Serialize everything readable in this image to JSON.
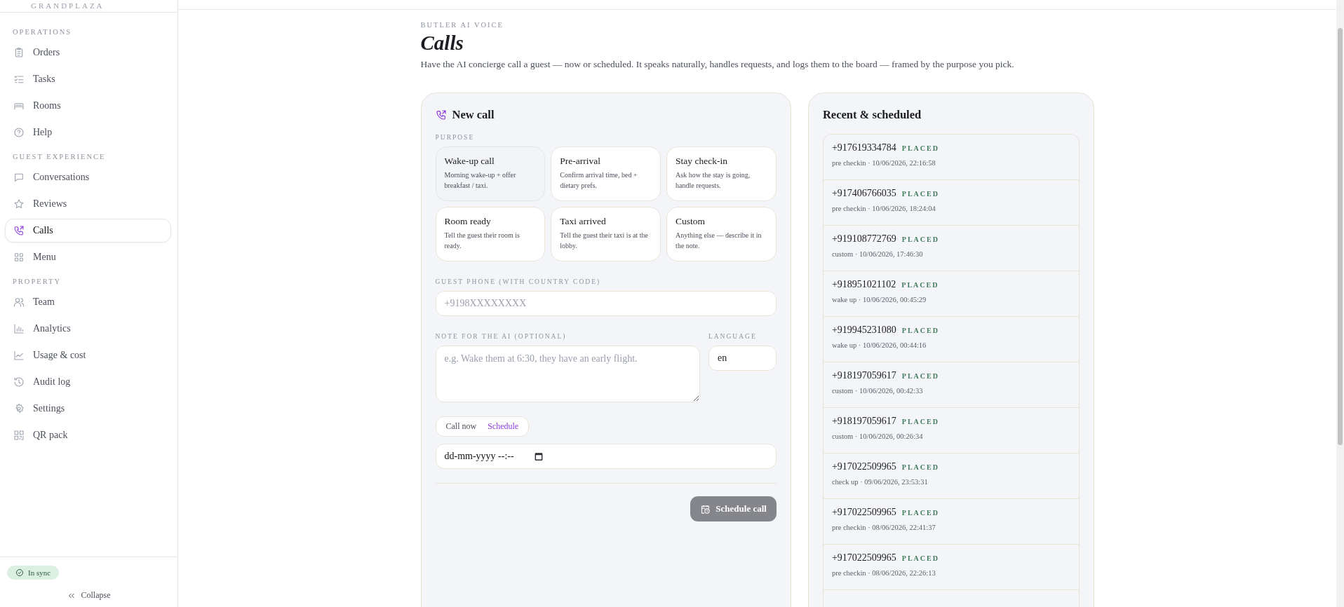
{
  "sidebar": {
    "brand": "GRANDPLAZA",
    "sections": [
      {
        "title": "OPERATIONS",
        "items": [
          {
            "label": "Orders",
            "selected": false
          },
          {
            "label": "Tasks",
            "selected": false
          },
          {
            "label": "Rooms",
            "selected": false
          },
          {
            "label": "Help",
            "selected": false
          }
        ]
      },
      {
        "title": "GUEST EXPERIENCE",
        "items": [
          {
            "label": "Conversations",
            "selected": false
          },
          {
            "label": "Reviews",
            "selected": false
          },
          {
            "label": "Calls",
            "selected": true
          },
          {
            "label": "Menu",
            "selected": false
          }
        ]
      },
      {
        "title": "PROPERTY",
        "items": [
          {
            "label": "Team",
            "selected": false
          },
          {
            "label": "Analytics",
            "selected": false
          },
          {
            "label": "Usage & cost",
            "selected": false
          },
          {
            "label": "Audit log",
            "selected": false
          },
          {
            "label": "Settings",
            "selected": false
          },
          {
            "label": "QR pack",
            "selected": false
          }
        ]
      }
    ],
    "sync_badge": "In sync",
    "collapse": "Collapse"
  },
  "page": {
    "eyebrow": "BUTLER AI VOICE",
    "title": "Calls",
    "subtitle": "Have the AI concierge call a guest — now or scheduled. It speaks naturally, handles requests, and logs them to the board — framed by the purpose you pick."
  },
  "new_call": {
    "title": "New call",
    "purpose_label": "PURPOSE",
    "purposes": [
      {
        "title": "Wake-up call",
        "description": "Morning wake-up + offer breakfast / taxi.",
        "selected": true
      },
      {
        "title": "Pre-arrival",
        "description": "Confirm arrival time, bed + dietary prefs.",
        "selected": false
      },
      {
        "title": "Stay check-in",
        "description": "Ask how the stay is going, handle requests.",
        "selected": false
      },
      {
        "title": "Room ready",
        "description": "Tell the guest their room is ready.",
        "selected": false
      },
      {
        "title": "Taxi arrived",
        "description": "Tell the guest their taxi is at the lobby.",
        "selected": false
      },
      {
        "title": "Custom",
        "description": "Anything else — describe it in the note.",
        "selected": false
      }
    ],
    "phone_label": "GUEST PHONE (WITH COUNTRY CODE)",
    "phone_placeholder": "+9198XXXXXXXX",
    "note_label": "NOTE FOR THE AI (OPTIONAL)",
    "note_placeholder": "e.g. Wake them at 6:30, they have an early flight.",
    "language_label": "LANGUAGE",
    "language_value": "en",
    "modes": [
      {
        "label": "Call now",
        "selected": false
      },
      {
        "label": "Schedule",
        "selected": true
      }
    ],
    "datetime_value": "dd-mm-yyyy --:--",
    "submit": {
      "label": "Schedule call",
      "disabled": true
    }
  },
  "recent": {
    "title": "Recent & scheduled",
    "calls": [
      {
        "phone": "+917619334784",
        "status": "PLACED",
        "meta": "pre checkin · 10/06/2026, 22:16:58"
      },
      {
        "phone": "+917406766035",
        "status": "PLACED",
        "meta": "pre checkin · 10/06/2026, 18:24:04"
      },
      {
        "phone": "+919108772769",
        "status": "PLACED",
        "meta": "custom · 10/06/2026, 17:46:30"
      },
      {
        "phone": "+918951021102",
        "status": "PLACED",
        "meta": "wake up · 10/06/2026, 00:45:29"
      },
      {
        "phone": "+919945231080",
        "status": "PLACED",
        "meta": "wake up · 10/06/2026, 00:44:16"
      },
      {
        "phone": "+918197059617",
        "status": "PLACED",
        "meta": "custom · 10/06/2026, 00:42:33"
      },
      {
        "phone": "+918197059617",
        "status": "PLACED",
        "meta": "custom · 10/06/2026, 00:26:34"
      },
      {
        "phone": "+917022509965",
        "status": "PLACED",
        "meta": "check up · 09/06/2026, 23:53:31"
      },
      {
        "phone": "+917022509965",
        "status": "PLACED",
        "meta": "pre checkin · 08/06/2026, 22:41:37"
      },
      {
        "phone": "+917022509965",
        "status": "PLACED",
        "meta": "pre checkin · 08/06/2026, 22:26:13"
      }
    ]
  }
}
